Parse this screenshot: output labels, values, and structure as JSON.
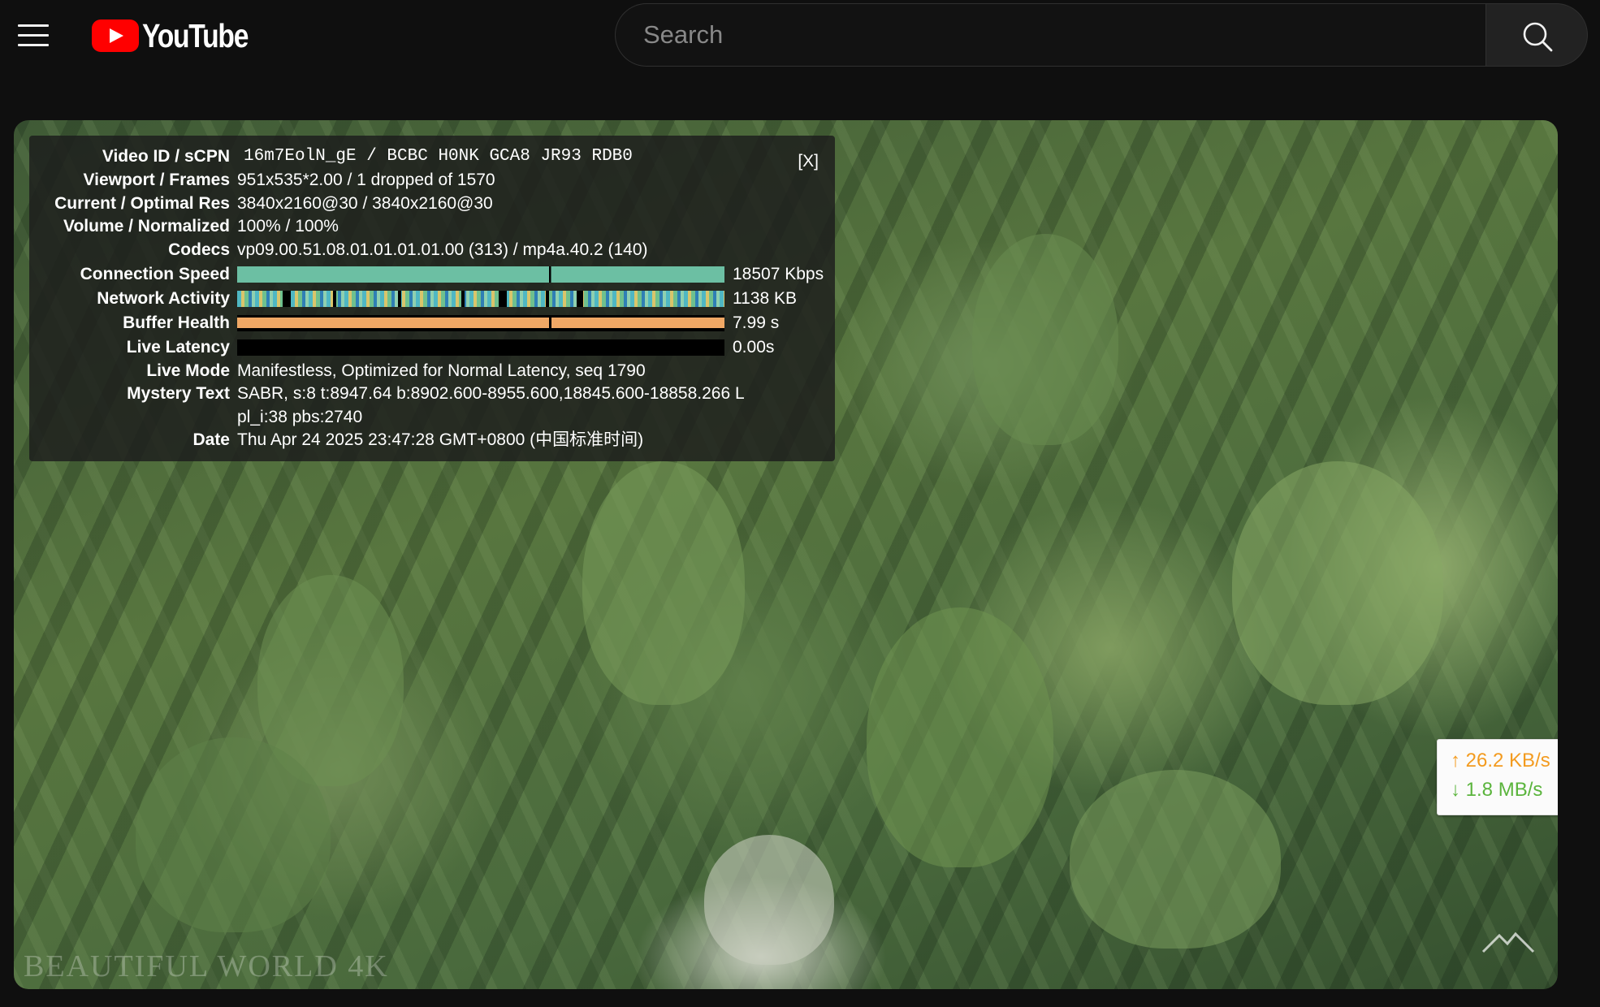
{
  "header": {
    "menu_icon": "hamburger-menu-icon",
    "logo_text": "YouTube",
    "search": {
      "placeholder": "Search",
      "value": ""
    },
    "search_icon": "search-icon"
  },
  "stats": {
    "close_label": "[X]",
    "rows": [
      {
        "label": "Video ID / sCPN",
        "value": "16m7EolN_gE / BCBC H0NK GCA8 JR93 RDB0"
      },
      {
        "label": "Viewport / Frames",
        "value": "951x535*2.00 / 1 dropped of 1570"
      },
      {
        "label": "Current / Optimal Res",
        "value": "3840x2160@30 / 3840x2160@30"
      },
      {
        "label": "Volume / Normalized",
        "value": "100% / 100%"
      },
      {
        "label": "Codecs",
        "value": "vp09.00.51.08.01.01.01.01.00 (313) / mp4a.40.2 (140)"
      },
      {
        "label": "Connection Speed",
        "value": "18507 Kbps"
      },
      {
        "label": "Network Activity",
        "value": "1138 KB"
      },
      {
        "label": "Buffer Health",
        "value": "7.99 s"
      },
      {
        "label": "Live Latency",
        "value": "0.00s"
      },
      {
        "label": "Live Mode",
        "value": "Manifestless, Optimized for Normal Latency, seq 1790"
      },
      {
        "label": "Mystery Text",
        "value": "SABR, s:8 t:8947.64 b:8902.600-8955.600,18845.600-18858.266 L"
      },
      {
        "label": "",
        "value": "pl_i:38 pbs:2740"
      },
      {
        "label": "Date",
        "value": "Thu Apr 24 2025 23:47:28 GMT+0800 (中国标准时间)"
      }
    ],
    "bar_colors": {
      "connection": "#6cbfa3",
      "buffer": "#f0a865"
    }
  },
  "speed_widget": {
    "upload": "↑ 26.2 KB/s",
    "download": "↓ 1.8 MB/s",
    "upload_color": "#f39b1f",
    "download_color": "#5ab43c"
  },
  "watermark": "BEAUTIFUL WORLD 4K"
}
